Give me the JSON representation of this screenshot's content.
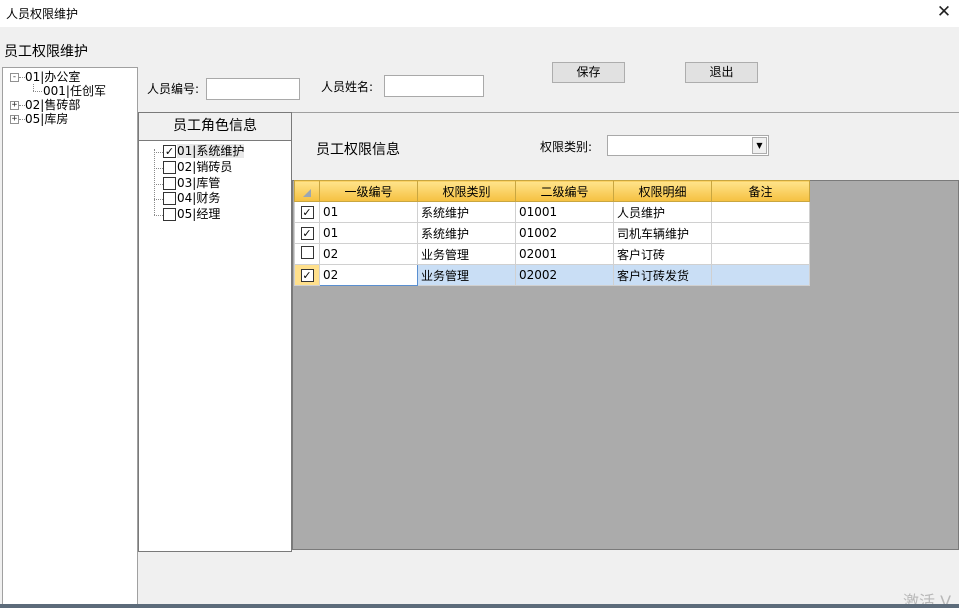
{
  "window": {
    "title": "人员权限维护",
    "close_glyph": "✕"
  },
  "form": {
    "heading": "员工权限维护"
  },
  "tree": {
    "nodes": [
      {
        "label": "01|办公室",
        "expander": "-"
      },
      {
        "label": "001|任创军"
      },
      {
        "label": "02|售砖部",
        "expander": "+"
      },
      {
        "label": "05|库房",
        "expander": "+"
      }
    ]
  },
  "filters": {
    "person_id_label": "人员编号:",
    "person_id_value": "",
    "person_name_label": "人员姓名:",
    "person_name_value": ""
  },
  "buttons": {
    "save": "保存",
    "exit": "退出"
  },
  "roles": {
    "header": "员工角色信息",
    "items": [
      {
        "label": "01|系统维护",
        "checked": true
      },
      {
        "label": "02|销砖员",
        "checked": false
      },
      {
        "label": "03|库管",
        "checked": false
      },
      {
        "label": "04|财务",
        "checked": false
      },
      {
        "label": "05|经理",
        "checked": false
      }
    ]
  },
  "permissions": {
    "header": "员工权限信息",
    "category_label": "权限类别:",
    "category_value": "",
    "columns": [
      "一级编号",
      "权限类别",
      "二级编号",
      "权限明细",
      "备注"
    ],
    "rows": [
      {
        "checked": true,
        "cells": [
          "01",
          "系统维护",
          "01001",
          "人员维护",
          ""
        ]
      },
      {
        "checked": true,
        "cells": [
          "01",
          "系统维护",
          "01002",
          "司机车辆维护",
          ""
        ]
      },
      {
        "checked": false,
        "cells": [
          "02",
          "业务管理",
          "02001",
          "客户订砖",
          ""
        ]
      },
      {
        "checked": true,
        "cells": [
          "02",
          "业务管理",
          "02002",
          "客户订砖发货",
          ""
        ]
      }
    ]
  },
  "watermark": "激活 V",
  "colors": {
    "header_gold": "#f5c040",
    "selected_row": "#c9def5",
    "grid_background": "#ababab"
  }
}
